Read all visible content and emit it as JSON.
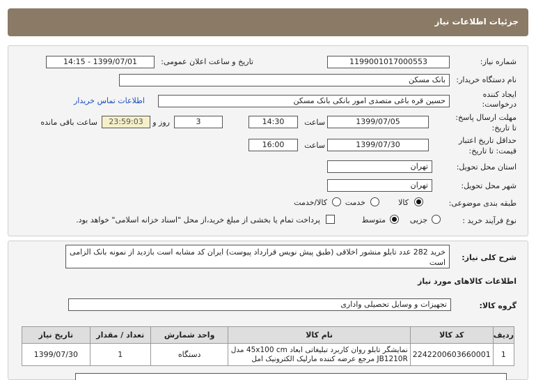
{
  "header": {
    "title": "جزئیات اطلاعات نیاز"
  },
  "form": {
    "need_number_label": "شماره نیاز:",
    "need_number": "1199001017000553",
    "announce_label": "تاریخ و ساعت اعلان عمومی:",
    "announce_value": "1399/07/01 - 14:15",
    "buyer_label": "نام دستگاه خریدار:",
    "buyer_value": "بانک مسکن",
    "creator_label_1": "ایجاد کننده",
    "creator_label_2": "درخواست:",
    "creator_value": "حسین  قره باغی متصدی امور بانکی بانک مسکن",
    "contact_link": "اطلاعات تماس خریدار",
    "reply_label_1": "مهلت ارسال پاسخ:",
    "reply_label_2": "تا تاریخ:",
    "reply_date": "1399/07/05",
    "time_label": "ساعت",
    "reply_time": "14:30",
    "days_value": "3",
    "days_label": "روز و",
    "remaining_value": "23:59:03",
    "remaining_label": "ساعت باقی مانده",
    "validity_label_1": "حداقل تاریخ اعتبار",
    "validity_label_2": "قیمت: تا تاریخ:",
    "validity_date": "1399/07/30",
    "validity_time": "16:00",
    "province_label": "استان محل تحویل:",
    "province_value": "تهران",
    "city_label": "شهر محل تحویل:",
    "city_value": "تهران",
    "category_label": "طبقه بندی موضوعی:",
    "category_options": [
      "کالا",
      "خدمت",
      "کالا/خدمت"
    ],
    "purchase_label": "نوع فرآیند خرید :",
    "purchase_options": [
      "جزیی",
      "متوسط"
    ],
    "payment_note": "پرداخت تمام یا بخشی از مبلغ خرید،از محل \"اسناد خزانه اسلامی\" خواهد بود."
  },
  "description": {
    "label": "شرح کلی نیاز:",
    "text": "خرید 282 عدد تابلو منشور اخلاقی (طبق پیش نویس قرارداد پیوست) ایران کد مشابه است بازدید از نمونه بانک الزامی است"
  },
  "goods": {
    "section_title": "اطلاعات کالاهای مورد نیاز",
    "group_label": "گروه کالا:",
    "group_value": "تجهیزات و وسایل تحصیلی واداری",
    "columns": [
      "ردیف",
      "کد کالا",
      "نام کالا",
      "واحد شمارش",
      "تعداد / مقدار",
      "تاریخ نیاز"
    ],
    "rows": [
      {
        "row": "1",
        "code": "2242200603660001",
        "name": "نمایشگر تابلو روان کاربرد تبلیغاتی ابعاد 45x100 cm مدل JB1210R مرجع عرضه کننده مارلیک الکترونیک امل",
        "unit": "دستگاه",
        "qty": "1",
        "date": "1399/07/30"
      }
    ]
  }
}
